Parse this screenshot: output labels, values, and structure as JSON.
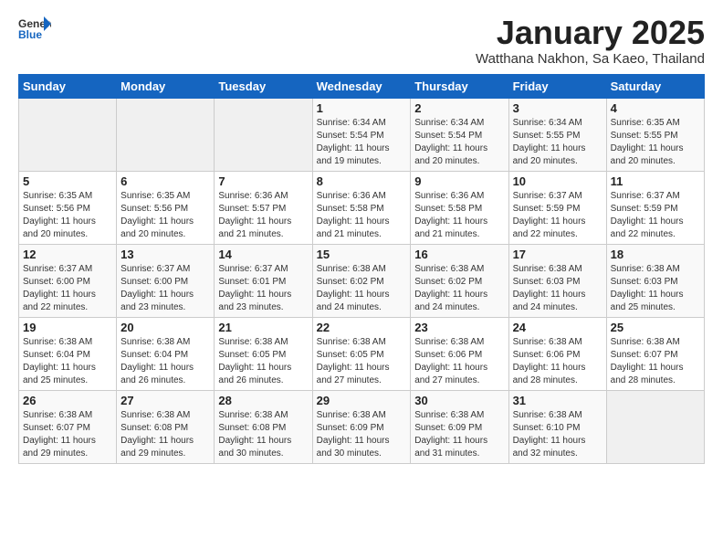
{
  "header": {
    "logo_general": "General",
    "logo_blue": "Blue",
    "month_title": "January 2025",
    "subtitle": "Watthana Nakhon, Sa Kaeo, Thailand"
  },
  "weekdays": [
    "Sunday",
    "Monday",
    "Tuesday",
    "Wednesday",
    "Thursday",
    "Friday",
    "Saturday"
  ],
  "weeks": [
    [
      {
        "day": "",
        "info": ""
      },
      {
        "day": "",
        "info": ""
      },
      {
        "day": "",
        "info": ""
      },
      {
        "day": "1",
        "info": "Sunrise: 6:34 AM\nSunset: 5:54 PM\nDaylight: 11 hours\nand 19 minutes."
      },
      {
        "day": "2",
        "info": "Sunrise: 6:34 AM\nSunset: 5:54 PM\nDaylight: 11 hours\nand 20 minutes."
      },
      {
        "day": "3",
        "info": "Sunrise: 6:34 AM\nSunset: 5:55 PM\nDaylight: 11 hours\nand 20 minutes."
      },
      {
        "day": "4",
        "info": "Sunrise: 6:35 AM\nSunset: 5:55 PM\nDaylight: 11 hours\nand 20 minutes."
      }
    ],
    [
      {
        "day": "5",
        "info": "Sunrise: 6:35 AM\nSunset: 5:56 PM\nDaylight: 11 hours\nand 20 minutes."
      },
      {
        "day": "6",
        "info": "Sunrise: 6:35 AM\nSunset: 5:56 PM\nDaylight: 11 hours\nand 20 minutes."
      },
      {
        "day": "7",
        "info": "Sunrise: 6:36 AM\nSunset: 5:57 PM\nDaylight: 11 hours\nand 21 minutes."
      },
      {
        "day": "8",
        "info": "Sunrise: 6:36 AM\nSunset: 5:58 PM\nDaylight: 11 hours\nand 21 minutes."
      },
      {
        "day": "9",
        "info": "Sunrise: 6:36 AM\nSunset: 5:58 PM\nDaylight: 11 hours\nand 21 minutes."
      },
      {
        "day": "10",
        "info": "Sunrise: 6:37 AM\nSunset: 5:59 PM\nDaylight: 11 hours\nand 22 minutes."
      },
      {
        "day": "11",
        "info": "Sunrise: 6:37 AM\nSunset: 5:59 PM\nDaylight: 11 hours\nand 22 minutes."
      }
    ],
    [
      {
        "day": "12",
        "info": "Sunrise: 6:37 AM\nSunset: 6:00 PM\nDaylight: 11 hours\nand 22 minutes."
      },
      {
        "day": "13",
        "info": "Sunrise: 6:37 AM\nSunset: 6:00 PM\nDaylight: 11 hours\nand 23 minutes."
      },
      {
        "day": "14",
        "info": "Sunrise: 6:37 AM\nSunset: 6:01 PM\nDaylight: 11 hours\nand 23 minutes."
      },
      {
        "day": "15",
        "info": "Sunrise: 6:38 AM\nSunset: 6:02 PM\nDaylight: 11 hours\nand 24 minutes."
      },
      {
        "day": "16",
        "info": "Sunrise: 6:38 AM\nSunset: 6:02 PM\nDaylight: 11 hours\nand 24 minutes."
      },
      {
        "day": "17",
        "info": "Sunrise: 6:38 AM\nSunset: 6:03 PM\nDaylight: 11 hours\nand 24 minutes."
      },
      {
        "day": "18",
        "info": "Sunrise: 6:38 AM\nSunset: 6:03 PM\nDaylight: 11 hours\nand 25 minutes."
      }
    ],
    [
      {
        "day": "19",
        "info": "Sunrise: 6:38 AM\nSunset: 6:04 PM\nDaylight: 11 hours\nand 25 minutes."
      },
      {
        "day": "20",
        "info": "Sunrise: 6:38 AM\nSunset: 6:04 PM\nDaylight: 11 hours\nand 26 minutes."
      },
      {
        "day": "21",
        "info": "Sunrise: 6:38 AM\nSunset: 6:05 PM\nDaylight: 11 hours\nand 26 minutes."
      },
      {
        "day": "22",
        "info": "Sunrise: 6:38 AM\nSunset: 6:05 PM\nDaylight: 11 hours\nand 27 minutes."
      },
      {
        "day": "23",
        "info": "Sunrise: 6:38 AM\nSunset: 6:06 PM\nDaylight: 11 hours\nand 27 minutes."
      },
      {
        "day": "24",
        "info": "Sunrise: 6:38 AM\nSunset: 6:06 PM\nDaylight: 11 hours\nand 28 minutes."
      },
      {
        "day": "25",
        "info": "Sunrise: 6:38 AM\nSunset: 6:07 PM\nDaylight: 11 hours\nand 28 minutes."
      }
    ],
    [
      {
        "day": "26",
        "info": "Sunrise: 6:38 AM\nSunset: 6:07 PM\nDaylight: 11 hours\nand 29 minutes."
      },
      {
        "day": "27",
        "info": "Sunrise: 6:38 AM\nSunset: 6:08 PM\nDaylight: 11 hours\nand 29 minutes."
      },
      {
        "day": "28",
        "info": "Sunrise: 6:38 AM\nSunset: 6:08 PM\nDaylight: 11 hours\nand 30 minutes."
      },
      {
        "day": "29",
        "info": "Sunrise: 6:38 AM\nSunset: 6:09 PM\nDaylight: 11 hours\nand 30 minutes."
      },
      {
        "day": "30",
        "info": "Sunrise: 6:38 AM\nSunset: 6:09 PM\nDaylight: 11 hours\nand 31 minutes."
      },
      {
        "day": "31",
        "info": "Sunrise: 6:38 AM\nSunset: 6:10 PM\nDaylight: 11 hours\nand 32 minutes."
      },
      {
        "day": "",
        "info": ""
      }
    ]
  ]
}
